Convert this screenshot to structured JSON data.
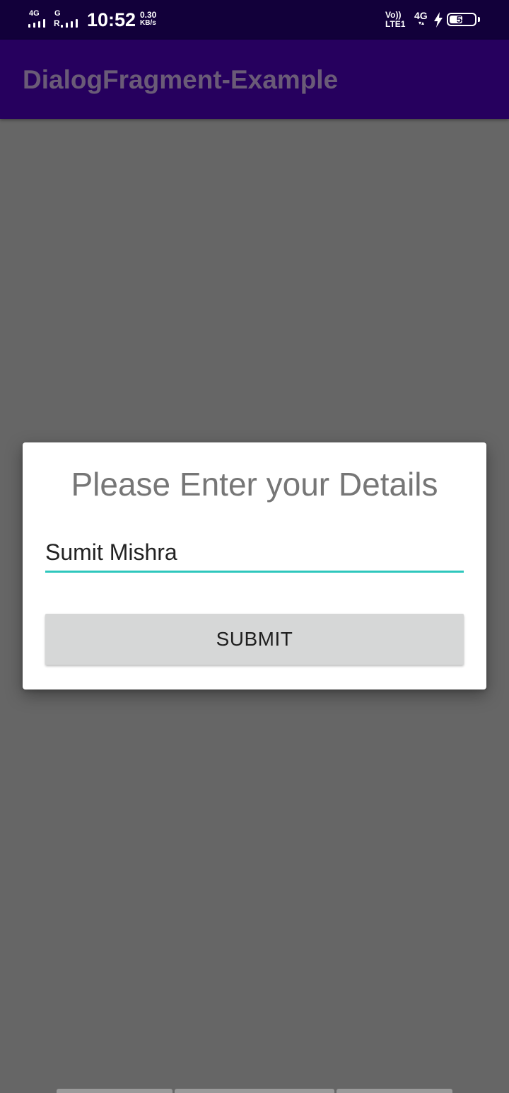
{
  "status_bar": {
    "network_1": "4G",
    "network_2": "G",
    "roaming": "R",
    "time": "10:52",
    "speed_value": "0.30",
    "speed_unit": "KB/s",
    "volte": "Vo))",
    "lte": "LTE1",
    "network_right": "4G",
    "battery_level": "54",
    "icons": {
      "signal_1": "signal-icon",
      "signal_2": "signal-icon",
      "charging": "charging-bolt-icon",
      "battery": "battery-icon"
    }
  },
  "app_bar": {
    "title": "DialogFragment-Example"
  },
  "dialog": {
    "title": "Please Enter your Details",
    "name_field_value": "Sumit Mishra",
    "submit_label": "SUBMIT"
  },
  "colors": {
    "status_bar_bg": "#12003a",
    "app_bar_bg": "#26005e",
    "scrim": "#666666",
    "accent": "#2ec7bd",
    "button_bg": "#d6d7d7"
  }
}
